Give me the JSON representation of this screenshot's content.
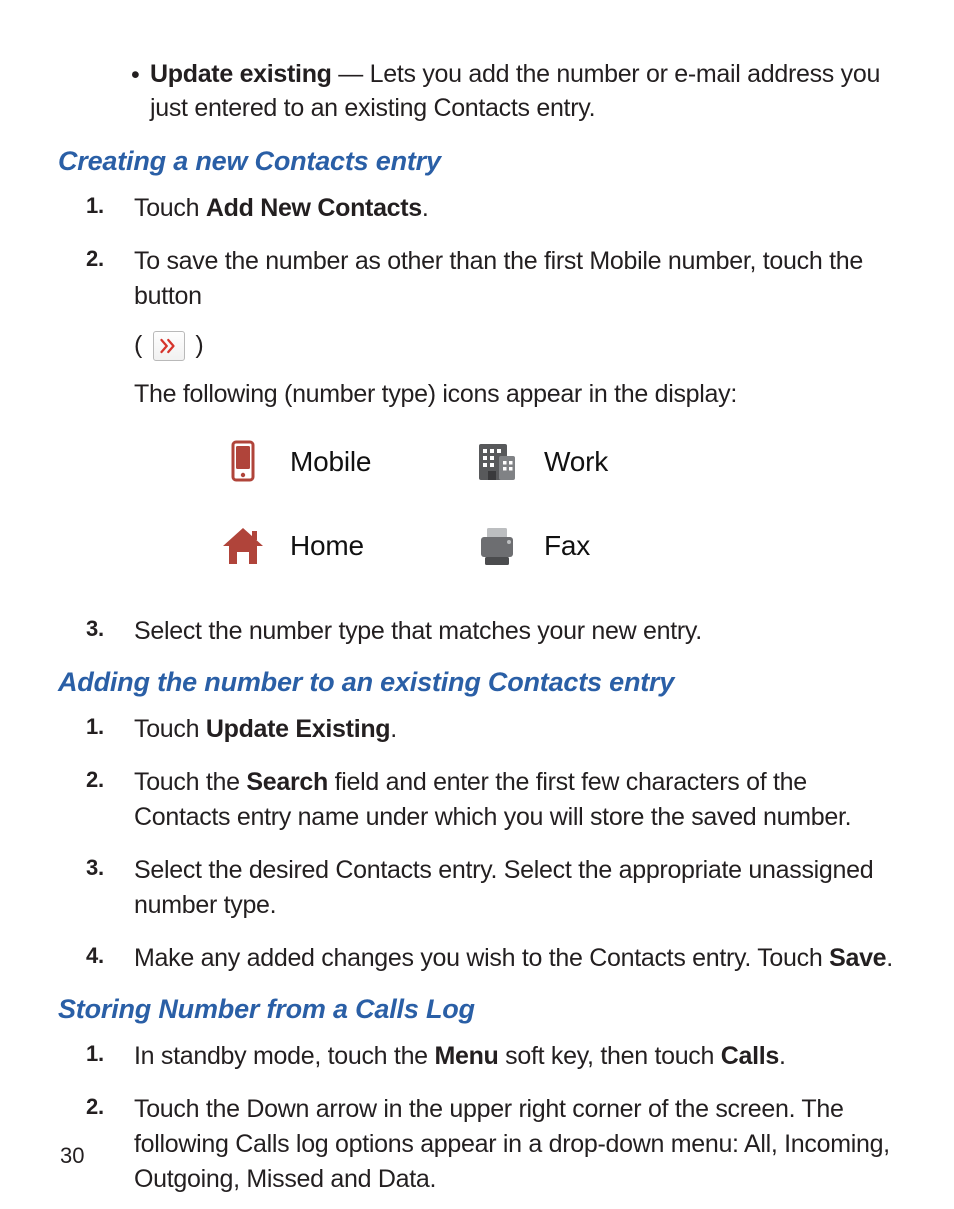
{
  "bullet": {
    "lead": "Update existing",
    "sep": " — ",
    "rest": "Lets you add the number or e-mail address you just entered to an existing Contacts entry."
  },
  "sections": {
    "creating": {
      "heading": "Creating a new Contacts entry",
      "steps": {
        "s1": {
          "num": "1.",
          "pre": "Touch ",
          "bold": "Add New Contacts",
          "post": "."
        },
        "s2": {
          "num": "2.",
          "line1": "To save the number as other than the first Mobile number, touch the button",
          "paren_open": "( ",
          "paren_close": " )",
          "line2": "The following (number type) icons appear in the display:"
        },
        "icons": {
          "mobile": "Mobile",
          "work": "Work",
          "home": "Home",
          "fax": "Fax"
        },
        "s3": {
          "num": "3.",
          "text": "Select the number type that matches your new entry."
        }
      }
    },
    "adding": {
      "heading": "Adding the number to an existing Contacts entry",
      "steps": {
        "s1": {
          "num": "1.",
          "pre": "Touch ",
          "bold": "Update Existing",
          "post": "."
        },
        "s2": {
          "num": "2.",
          "pre": "Touch the ",
          "bold": "Search",
          "post": " field and enter the first few characters of the Contacts entry name under which you will store the saved number."
        },
        "s3": {
          "num": "3.",
          "text": "Select the desired Contacts entry. Select the appropriate unassigned number type."
        },
        "s4": {
          "num": "4.",
          "pre": "Make any added changes you wish to the Contacts entry. Touch ",
          "bold": "Save",
          "post": "."
        }
      }
    },
    "storing": {
      "heading": "Storing Number from a Calls Log",
      "steps": {
        "s1": {
          "num": "1.",
          "pre": "In standby mode, touch the ",
          "bold1": "Menu",
          "mid": " soft key, then touch ",
          "bold2": "Calls",
          "post": "."
        },
        "s2": {
          "num": "2.",
          "text": "Touch the Down arrow in the upper right corner of the screen. The following Calls log options appear in a drop-down menu: All, Incoming, Outgoing, Missed and Data."
        }
      }
    }
  },
  "page_number": "30"
}
